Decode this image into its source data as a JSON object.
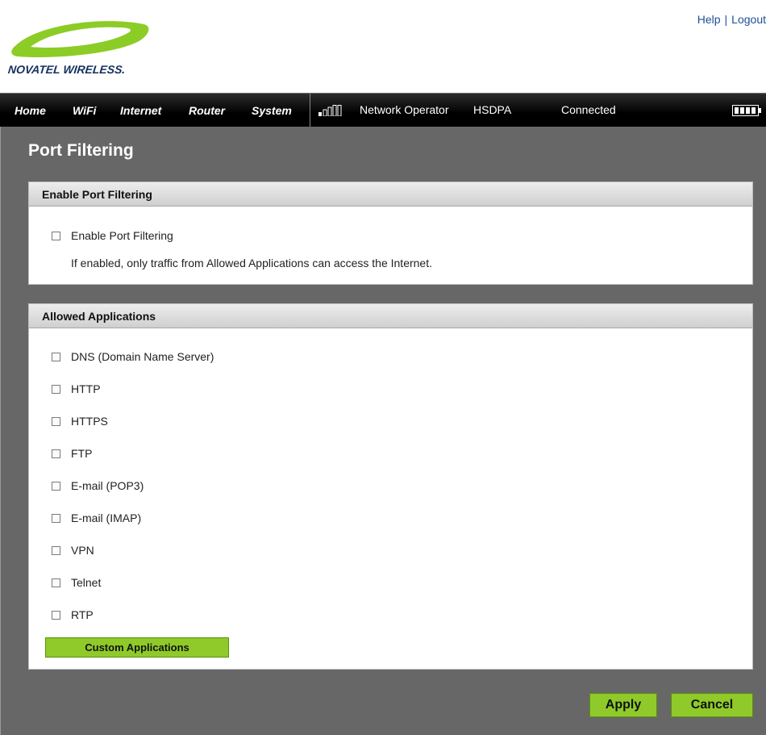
{
  "header": {
    "brand": "NOVATEL WIRELESS.",
    "links": {
      "help": "Help",
      "separator": "|",
      "logout": "Logout"
    },
    "logo_color": "#8ccc26"
  },
  "nav": {
    "items": [
      "Home",
      "WiFi",
      "Internet",
      "Router",
      "System"
    ]
  },
  "status": {
    "signal_icon": "signal-bars-icon",
    "operator": "Network Operator",
    "technology": "HSDPA",
    "connection": "Connected",
    "battery_icon": "battery-icon"
  },
  "page": {
    "title": "Port Filtering"
  },
  "enable_section": {
    "heading": "Enable Port Filtering",
    "checkbox_label": "Enable Port Filtering",
    "checked": false,
    "note": "If enabled, only traffic from Allowed Applications can access the Internet."
  },
  "allowed_section": {
    "heading": "Allowed Applications",
    "items": [
      {
        "label": "DNS (Domain Name Server)",
        "checked": false
      },
      {
        "label": "HTTP",
        "checked": false
      },
      {
        "label": "HTTPS",
        "checked": false
      },
      {
        "label": "FTP",
        "checked": false
      },
      {
        "label": "E-mail (POP3)",
        "checked": false
      },
      {
        "label": "E-mail (IMAP)",
        "checked": false
      },
      {
        "label": "VPN",
        "checked": false
      },
      {
        "label": "Telnet",
        "checked": false
      },
      {
        "label": "RTP",
        "checked": false
      }
    ],
    "custom_button": "Custom Applications"
  },
  "actions": {
    "apply": "Apply",
    "cancel": "Cancel"
  },
  "colors": {
    "accent_green": "#8fca2a",
    "content_bg": "#676767",
    "link_blue": "#1e4f96"
  }
}
